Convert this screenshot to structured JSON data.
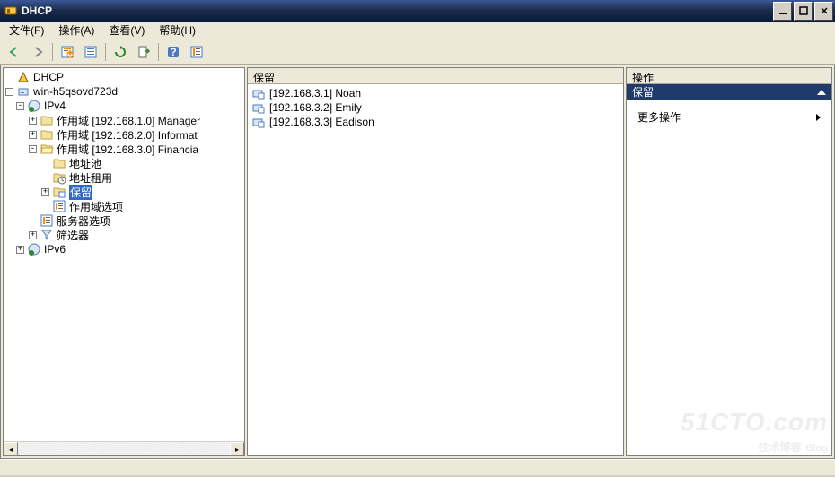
{
  "window": {
    "title": "DHCP"
  },
  "menu": {
    "file": "文件(F)",
    "action": "操作(A)",
    "view": "查看(V)",
    "help": "帮助(H)"
  },
  "tree": {
    "root": "DHCP",
    "server": "win-h5qsovd723d",
    "ipv4": "IPv4",
    "scope1": "作用域 [192.168.1.0] Manager",
    "scope2": "作用域 [192.168.2.0] Informat",
    "scope3": "作用域 [192.168.3.0] Financia",
    "addrpool": "地址池",
    "addrlease": "地址租用",
    "reservations": "保留",
    "scopeoptions": "作用域选项",
    "serveropts": "服务器选项",
    "filters": "筛选器",
    "ipv6": "IPv6"
  },
  "list": {
    "header": "保留",
    "items": [
      {
        "text": "[192.168.3.1] Noah"
      },
      {
        "text": "[192.168.3.2] Emily"
      },
      {
        "text": "[192.168.3.3] Eadison"
      }
    ]
  },
  "actions": {
    "header": "操作",
    "subheader": "保留",
    "more": "更多操作"
  },
  "watermark": {
    "top": "51CTO.com",
    "bottom": "技术博客",
    "blog": "Blog"
  }
}
